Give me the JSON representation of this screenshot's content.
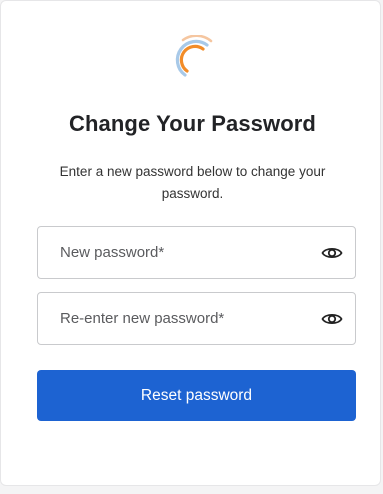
{
  "logo": {
    "icon": "brand-logo-icon",
    "colors": [
      "#f28c28",
      "#a8c9e8",
      "#f5c6a0"
    ]
  },
  "heading": "Change Your Password",
  "description": "Enter a new password below to change your password.",
  "fields": [
    {
      "placeholder": "New password*",
      "value": "",
      "icon": "eye-icon"
    },
    {
      "placeholder": "Re-enter new password*",
      "value": "",
      "icon": "eye-icon"
    }
  ],
  "submit_label": "Reset password",
  "colors": {
    "accent": "#1d63d2",
    "text": "#222326",
    "border": "#c9cacd"
  }
}
